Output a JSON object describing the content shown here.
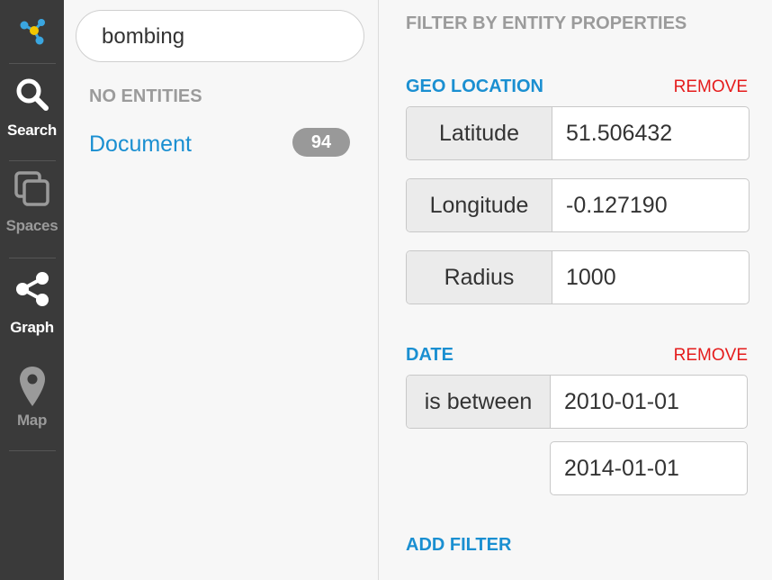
{
  "nav": {
    "items": [
      {
        "label": "Search",
        "icon": "search-icon"
      },
      {
        "label": "Spaces",
        "icon": "spaces-icon"
      },
      {
        "label": "Graph",
        "icon": "share-graph-icon"
      },
      {
        "label": "Map",
        "icon": "map-pin-icon"
      }
    ],
    "logo_icon": "graph-logo-icon"
  },
  "search": {
    "query": "bombing",
    "no_entities_label": "NO ENTITIES",
    "results": [
      {
        "name": "Document",
        "count": "94"
      }
    ]
  },
  "filters": {
    "heading": "FILTER BY ENTITY PROPERTIES",
    "geo": {
      "title": "GEO LOCATION",
      "remove_label": "REMOVE",
      "latitude_label": "Latitude",
      "latitude_value": "51.506432",
      "longitude_label": "Longitude",
      "longitude_value": "-0.127190",
      "radius_label": "Radius",
      "radius_value": "1000"
    },
    "date": {
      "title": "DATE",
      "remove_label": "REMOVE",
      "operator_label": "is between",
      "start_value": "2010-01-01",
      "end_value": "2014-01-01"
    },
    "add_filter_label": "ADD FILTER"
  },
  "colors": {
    "rail": "#3a3a3a",
    "accent": "#1a8fd1",
    "remove": "#e51c1c",
    "badge": "#999999"
  }
}
